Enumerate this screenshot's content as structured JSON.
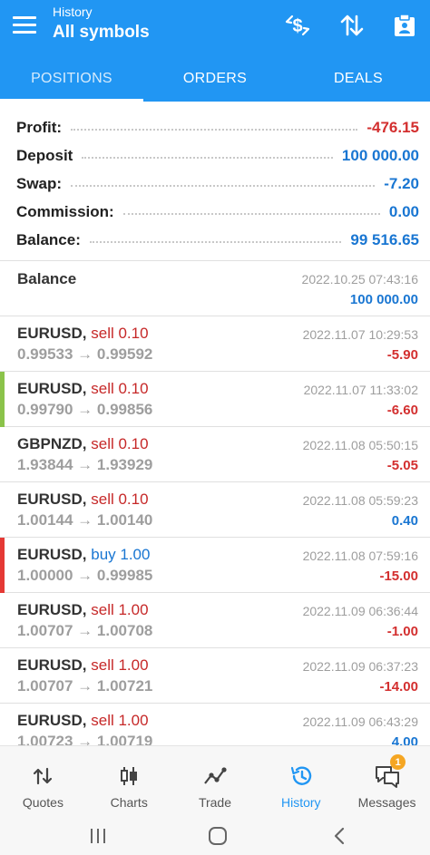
{
  "header": {
    "subtitle": "History",
    "title": "All symbols",
    "icons": [
      "dollar-swap-icon",
      "sort-arrows-icon",
      "report-icon"
    ],
    "bar_color": "#2196f3"
  },
  "tabs": [
    {
      "label": "POSITIONS",
      "active": true
    },
    {
      "label": "ORDERS",
      "active": false
    },
    {
      "label": "DEALS",
      "active": false
    }
  ],
  "summary": [
    {
      "label": "Profit:",
      "value": "-476.15",
      "color": "red"
    },
    {
      "label": "Deposit",
      "value": "100 000.00",
      "color": "blue"
    },
    {
      "label": "Swap:",
      "value": "-7.20",
      "color": "blue"
    },
    {
      "label": "Commission:",
      "value": "0.00",
      "color": "blue"
    },
    {
      "label": "Balance:",
      "value": "99 516.65",
      "color": "blue"
    }
  ],
  "balance_entry": {
    "title": "Balance",
    "time": "2022.10.25 07:43:16",
    "amount": "100 000.00"
  },
  "deals": [
    {
      "symbol": "EURUSD,",
      "op": "sell 0.10",
      "side": "sell",
      "prices": "0.99533 → 0.99592",
      "time": "2022.11.07 10:29:53",
      "profit": "-5.90",
      "marker": ""
    },
    {
      "symbol": "EURUSD,",
      "op": "sell 0.10",
      "side": "sell",
      "prices": "0.99790 → 0.99856",
      "time": "2022.11.07 11:33:02",
      "profit": "-6.60",
      "marker": "#8bc34a"
    },
    {
      "symbol": "GBPNZD,",
      "op": "sell 0.10",
      "side": "sell",
      "prices": "1.93844 → 1.93929",
      "time": "2022.11.08 05:50:15",
      "profit": "-5.05",
      "marker": ""
    },
    {
      "symbol": "EURUSD,",
      "op": "sell 0.10",
      "side": "sell",
      "prices": "1.00144 → 1.00140",
      "time": "2022.11.08 05:59:23",
      "profit": "0.40",
      "marker": ""
    },
    {
      "symbol": "EURUSD,",
      "op": "buy 1.00",
      "side": "buy",
      "prices": "1.00000 → 0.99985",
      "time": "2022.11.08 07:59:16",
      "profit": "-15.00",
      "marker": "#e53935"
    },
    {
      "symbol": "EURUSD,",
      "op": "sell 1.00",
      "side": "sell",
      "prices": "1.00707 → 1.00708",
      "time": "2022.11.09 06:36:44",
      "profit": "-1.00",
      "marker": ""
    },
    {
      "symbol": "EURUSD,",
      "op": "sell 1.00",
      "side": "sell",
      "prices": "1.00707 → 1.00721",
      "time": "2022.11.09 06:37:23",
      "profit": "-14.00",
      "marker": ""
    },
    {
      "symbol": "EURUSD,",
      "op": "sell 1.00",
      "side": "sell",
      "prices": "1.00723 → 1.00719",
      "time": "2022.11.09 06:43:29",
      "profit": "4.00",
      "marker": ""
    }
  ],
  "bottom_nav": [
    {
      "label": "Quotes",
      "icon": "quotes-arrows-icon",
      "active": false
    },
    {
      "label": "Charts",
      "icon": "candlestick-icon",
      "active": false
    },
    {
      "label": "Trade",
      "icon": "trade-line-icon",
      "active": false
    },
    {
      "label": "History",
      "icon": "history-clock-icon",
      "active": true
    },
    {
      "label": "Messages",
      "icon": "messages-icon",
      "active": false,
      "badge": "1"
    }
  ],
  "colors": {
    "red": "#d32f2f",
    "blue": "#1976d2",
    "accent": "#2196f3"
  }
}
